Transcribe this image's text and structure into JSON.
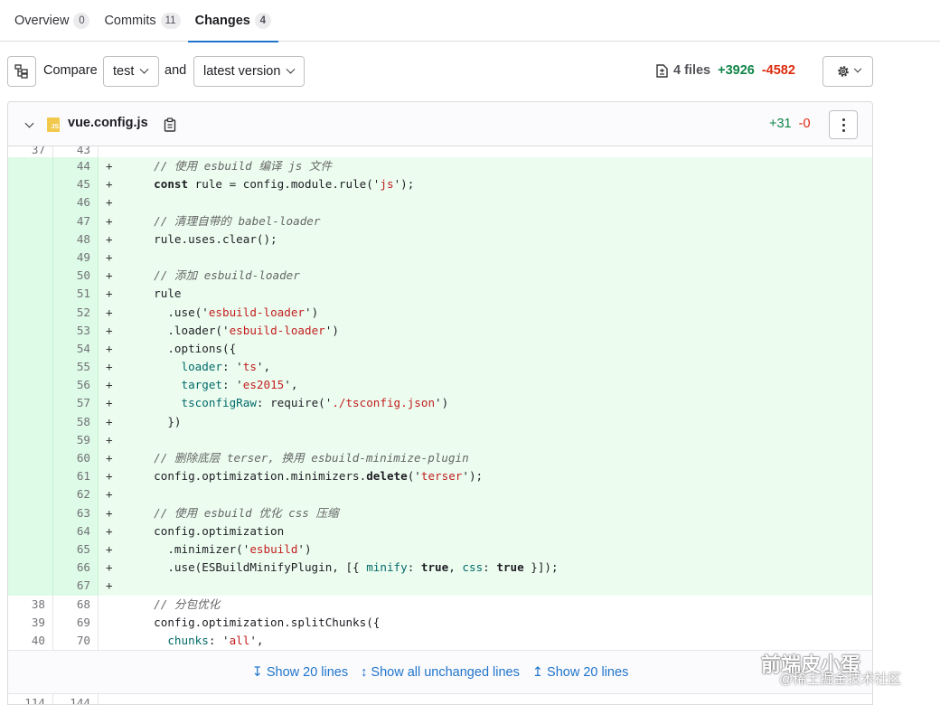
{
  "tabs": [
    {
      "label": "Overview",
      "count": "0"
    },
    {
      "label": "Commits",
      "count": "11"
    },
    {
      "label": "Changes",
      "count": "4"
    }
  ],
  "compare": {
    "label": "Compare",
    "source": "test",
    "and_label": "and",
    "target": "latest version"
  },
  "stats": {
    "files": "4 files",
    "additions": "+3926",
    "deletions": "-4582"
  },
  "file": {
    "name": "vue.config.js",
    "additions": "+31",
    "deletions": "-0"
  },
  "lines": [
    {
      "old": "37",
      "new": "43",
      "type": "cut",
      "code": ""
    },
    {
      "old": "",
      "new": "44",
      "type": "add",
      "code": "  // 使用 esbuild 编译 js 文件"
    },
    {
      "old": "",
      "new": "45",
      "type": "add",
      "code": "  const rule = config.module.rule('js');"
    },
    {
      "old": "",
      "new": "46",
      "type": "add",
      "code": ""
    },
    {
      "old": "",
      "new": "47",
      "type": "add",
      "code": "  // 清理自带的 babel-loader"
    },
    {
      "old": "",
      "new": "48",
      "type": "add",
      "code": "  rule.uses.clear();"
    },
    {
      "old": "",
      "new": "49",
      "type": "add",
      "code": ""
    },
    {
      "old": "",
      "new": "50",
      "type": "add",
      "code": "  // 添加 esbuild-loader"
    },
    {
      "old": "",
      "new": "51",
      "type": "add",
      "code": "  rule"
    },
    {
      "old": "",
      "new": "52",
      "type": "add",
      "code": "    .use('esbuild-loader')"
    },
    {
      "old": "",
      "new": "53",
      "type": "add",
      "code": "    .loader('esbuild-loader')"
    },
    {
      "old": "",
      "new": "54",
      "type": "add",
      "code": "    .options({"
    },
    {
      "old": "",
      "new": "55",
      "type": "add",
      "code": "      loader: 'ts',"
    },
    {
      "old": "",
      "new": "56",
      "type": "add",
      "code": "      target: 'es2015',"
    },
    {
      "old": "",
      "new": "57",
      "type": "add",
      "code": "      tsconfigRaw: require('./tsconfig.json')"
    },
    {
      "old": "",
      "new": "58",
      "type": "add",
      "code": "    })"
    },
    {
      "old": "",
      "new": "59",
      "type": "add",
      "code": ""
    },
    {
      "old": "",
      "new": "60",
      "type": "add",
      "code": "  // 删除底层 terser, 换用 esbuild-minimize-plugin"
    },
    {
      "old": "",
      "new": "61",
      "type": "add",
      "code": "  config.optimization.minimizers.delete('terser');"
    },
    {
      "old": "",
      "new": "62",
      "type": "add",
      "code": ""
    },
    {
      "old": "",
      "new": "63",
      "type": "add",
      "code": "  // 使用 esbuild 优化 css 压缩"
    },
    {
      "old": "",
      "new": "64",
      "type": "add",
      "code": "  config.optimization"
    },
    {
      "old": "",
      "new": "65",
      "type": "add",
      "code": "    .minimizer('esbuild')"
    },
    {
      "old": "",
      "new": "66",
      "type": "add",
      "code": "    .use(ESBuildMinifyPlugin, [{ minify: true, css: true }]);"
    },
    {
      "old": "",
      "new": "67",
      "type": "add",
      "code": ""
    },
    {
      "old": "38",
      "new": "68",
      "type": "ctx",
      "code": "  // 分包优化"
    },
    {
      "old": "39",
      "new": "69",
      "type": "ctx",
      "code": "  config.optimization.splitChunks({"
    },
    {
      "old": "40",
      "new": "70",
      "type": "ctx",
      "code": "    chunks: 'all',"
    }
  ],
  "expand": {
    "up": "↧ Show 20 lines",
    "all": "↕ Show all unchanged lines",
    "down": "↥ Show 20 lines"
  },
  "bottom_line": {
    "old": "114",
    "new": "144"
  },
  "watermark": {
    "line1": "前端皮小蛋",
    "line2": "@稀土掘金技术社区"
  },
  "colors": {
    "accent": "#1f75cb",
    "add": "#108548",
    "del": "#dd2b0e",
    "add_bg": "#ecfdf0"
  }
}
